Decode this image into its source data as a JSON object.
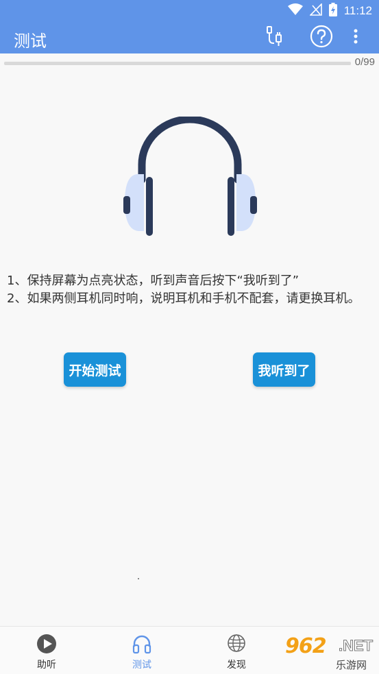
{
  "status_bar": {
    "time": "11:12"
  },
  "app_bar": {
    "title": "测试"
  },
  "progress": {
    "text": "0/99",
    "fraction": 0
  },
  "instructions": [
    "1、保持屏幕为点亮状态，听到声音后按下“我听到了”",
    "2、如果两侧耳机同时响，说明耳机和手机不配套，请更换耳机。"
  ],
  "buttons": {
    "start": "开始测试",
    "heard": "我听到了"
  },
  "bottom_nav": [
    {
      "label": "助听",
      "icon": "play-circle-icon"
    },
    {
      "label": "测试",
      "icon": "headphones-icon",
      "active": true
    },
    {
      "label": "发现",
      "icon": "globe-icon"
    }
  ],
  "watermark": {
    "number": "962",
    "net": ".NET",
    "site": "乐游网"
  },
  "colors": {
    "primary": "#5f94e8",
    "button": "#1a91d8",
    "headphone_dark": "#2b3a5a",
    "headphone_light": "#d3e0fa"
  }
}
